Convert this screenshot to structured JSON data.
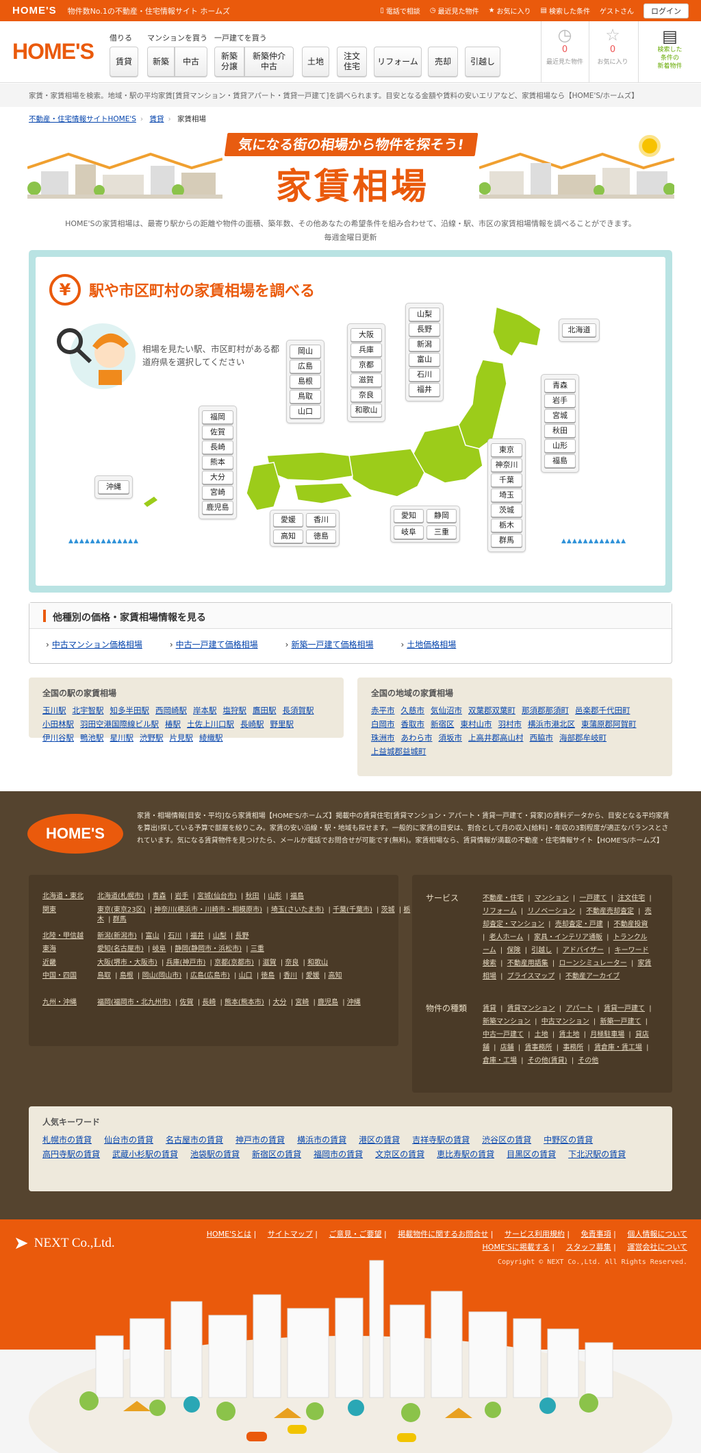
{
  "topbar": {
    "logo": "HOME'S",
    "tagline": "物件数No.1の不動産・住宅情報サイト ホームズ",
    "phone": "電話で相談",
    "recent": "最近見た物件",
    "favorites": "お気に入り",
    "search_conditions": "検索した条件",
    "guest": "ゲストさん",
    "login": "ログイン"
  },
  "header": {
    "logo": "HOME'S",
    "groups": [
      "借りる",
      "マンションを買う",
      "一戸建てを買う"
    ],
    "nav": [
      "賃貸",
      "新築",
      "中古",
      "新築\n分譲",
      "新築仲介\n中古",
      "土地",
      "注文\n住宅",
      "リフォーム",
      "売却",
      "引越し"
    ],
    "history": [
      {
        "label": "最近見た物件",
        "count": "0"
      },
      {
        "label": "お気に入り",
        "count": "0"
      },
      {
        "label": "検索した\n条件の\n新着物件",
        "count": ""
      }
    ]
  },
  "description": "家賃・家賃相場を検索。地域・駅の平均家賃[賃貸マンション・賃貸アパート・賃貸一戸建て]を調べられます。目安となる金額や賃料の安いエリアなど、家賃相場なら【HOME'S/ホームズ】",
  "breadcrumb": [
    "不動産・住宅情報サイトHOME'S",
    "賃貸",
    "家賃相場"
  ],
  "hero": {
    "banner": "気になる街の相場から物件を探そう!",
    "title": "家賃相場",
    "text1": "HOME'Sの家賃相場は、最寄り駅からの距離や物件の面積、築年数、その他あなたの希望条件を組み合わせて、沿線・駅、市区の家賃相場情報を調べることができます。",
    "text2": "毎週金曜日更新"
  },
  "map": {
    "title": "駅や市区町村の家賃相場を調べる",
    "mascot_text": "相場を見たい駅、市区町村がある都道府県を選択してください",
    "okinawa": [
      "沖縄"
    ],
    "kyushu": [
      "福岡",
      "佐賀",
      "長崎",
      "熊本",
      "大分",
      "宮崎",
      "鹿児島"
    ],
    "shikoku": [
      "愛媛",
      "香川",
      "高知",
      "徳島"
    ],
    "chugoku": [
      "岡山",
      "広島",
      "島根",
      "鳥取",
      "山口"
    ],
    "kansai": [
      "大阪",
      "兵庫",
      "京都",
      "滋賀",
      "奈良",
      "和歌山"
    ],
    "tokai": [
      "愛知",
      "静岡",
      "岐阜",
      "三重"
    ],
    "hokuriku": [
      "山梨",
      "長野",
      "新潟",
      "富山",
      "石川",
      "福井"
    ],
    "kanto": [
      "東京",
      "神奈川",
      "千葉",
      "埼玉",
      "茨城",
      "栃木",
      "群馬"
    ],
    "tohoku": [
      "青森",
      "岩手",
      "宮城",
      "秋田",
      "山形",
      "福島"
    ],
    "hokkaido": [
      "北海道"
    ]
  },
  "other": {
    "title": "他種別の価格・家賃相場情報を見る",
    "links": [
      "中古マンション価格相場",
      "中古一戸建て価格相場",
      "新築一戸建て価格相場",
      "土地価格相場"
    ]
  },
  "stations": {
    "title": "全国の駅の家賃相場",
    "items": [
      "玉川駅",
      "北宇智駅",
      "知多半田駅",
      "西岡崎駅",
      "岸本駅",
      "塩狩駅",
      "鷹田駅",
      "長須賀駅",
      "小田林駅",
      "羽田空港国際線ビル駅",
      "椿駅",
      "土佐上川口駅",
      "長崎駅",
      "野里駅",
      "伊川谷駅",
      "鴨池駅",
      "星川駅",
      "渋野駅",
      "片見駅",
      "綾織駅"
    ]
  },
  "areas": {
    "title": "全国の地域の家賃相場",
    "items": [
      "赤平市",
      "久慈市",
      "気仙沼市",
      "双葉郡双葉町",
      "那須郡那須町",
      "邑楽郡千代田町",
      "白岡市",
      "香取市",
      "新宿区",
      "東村山市",
      "羽村市",
      "横浜市港北区",
      "東蒲原郡阿賀町",
      "珠洲市",
      "あわら市",
      "須坂市",
      "上高井郡高山村",
      "西脇市",
      "海部郡牟岐町",
      "上益城郡益城町"
    ]
  },
  "footer": {
    "logo": "HOME'S",
    "description": "家賃・相場情報[目安・平均]なら家賃相場【HOME'S/ホームズ】掲載中の賃貸住宅[賃貸マンション・アパート・賃貸一戸建て・貸家]の賃料データから、目安となる平均家賃を算出!探している予算で部屋を絞りこみ。家賃の安い沿線・駅・地域も探せます。一般的に家賃の目安は、割合として月の収入[給料]・年収の3割程度が適正なバランスとされています。気になる賃貸物件を見つけたら、メールか電話でお問合せが可能です(無料)。家賃相場なら、賃貸情報が満載の不動産・住宅情報サイト【HOME'S/ホームズ】",
    "regions": [
      {
        "label": "北海道・東北",
        "prefs": [
          "北海道(札幌市)",
          "青森",
          "岩手",
          "宮城(仙台市)",
          "秋田",
          "山形",
          "福島"
        ]
      },
      {
        "label": "関東",
        "prefs": [
          "東京(東京23区)",
          "神奈川(横浜市・川崎市・相模原市)",
          "埼玉(さいたま市)",
          "千葉(千葉市)",
          "茨城",
          "栃木",
          "群馬"
        ]
      },
      {
        "label": "北陸・甲信越",
        "prefs": [
          "新潟(新潟市)",
          "富山",
          "石川",
          "福井",
          "山梨",
          "長野"
        ]
      },
      {
        "label": "東海",
        "prefs": [
          "愛知(名古屋市)",
          "岐阜",
          "静岡(静岡市・浜松市)",
          "三重"
        ]
      },
      {
        "label": "近畿",
        "prefs": [
          "大阪(堺市・大阪市)",
          "兵庫(神戸市)",
          "京都(京都市)",
          "滋賀",
          "奈良",
          "和歌山"
        ]
      },
      {
        "label": "中国・四国",
        "prefs": [
          "鳥取",
          "島根",
          "岡山(岡山市)",
          "広島(広島市)",
          "山口",
          "徳島",
          "香川",
          "愛媛",
          "高知"
        ]
      },
      {
        "label": "九州・沖縄",
        "prefs": [
          "福岡(福岡市・北九州市)",
          "佐賀",
          "長崎",
          "熊本(熊本市)",
          "大分",
          "宮崎",
          "鹿児島",
          "沖縄"
        ]
      }
    ],
    "service_title": "サービス",
    "services": [
      "不動産・住宅",
      "マンション",
      "一戸建て",
      "注文住宅",
      "リフォーム",
      "リノベーション",
      "不動産売却査定",
      "売却査定・マンション",
      "売却査定・戸建",
      "不動産投資",
      "老人ホーム",
      "家具・インテリア通販",
      "トランクルーム",
      "保険",
      "引越し",
      "アドバイザー",
      "キーワード検索",
      "不動産用語集",
      "ローンシミュレーター",
      "家賃相場",
      "プライスマップ",
      "不動産アーカイブ"
    ],
    "types_title": "物件の種類",
    "types": [
      "賃貸",
      "賃貸マンション",
      "アパート",
      "賃貸一戸建て",
      "新築マンション",
      "中古マンション",
      "新築一戸建て",
      "中古一戸建て",
      "土地",
      "賃土地",
      "月極駐車場",
      "貸店舗",
      "店舗",
      "賃事務所",
      "事務所",
      "賃倉庫・賃工場",
      "倉庫・工場",
      "その他(賃貸)",
      "その他"
    ]
  },
  "keywords": {
    "title": "人気キーワード",
    "items": [
      "札幌市の賃貸",
      "仙台市の賃貸",
      "名古屋市の賃貸",
      "神戸市の賃貸",
      "横浜市の賃貸",
      "港区の賃貸",
      "吉祥寺駅の賃貸",
      "渋谷区の賃貸",
      "中野区の賃貸",
      "高円寺駅の賃貸",
      "武蔵小杉駅の賃貸",
      "池袋駅の賃貸",
      "新宿区の賃貸",
      "福岡市の賃貸",
      "文京区の賃貸",
      "恵比寿駅の賃貸",
      "目黒区の賃貸",
      "下北沢駅の賃貸"
    ]
  },
  "bottom": {
    "company": "NEXT Co.,Ltd.",
    "links1": [
      "HOME'Sとは",
      "サイトマップ",
      "ご意見・ご要望",
      "掲載物件に関するお問合せ",
      "サービス利用規約",
      "免責事項",
      "個人情報について"
    ],
    "links2": [
      "HOME'Sに掲載する",
      "スタッフ募集",
      "運営会社について"
    ],
    "copyright": "Copyright © NEXT Co.,Ltd. All Rights Reserved."
  }
}
